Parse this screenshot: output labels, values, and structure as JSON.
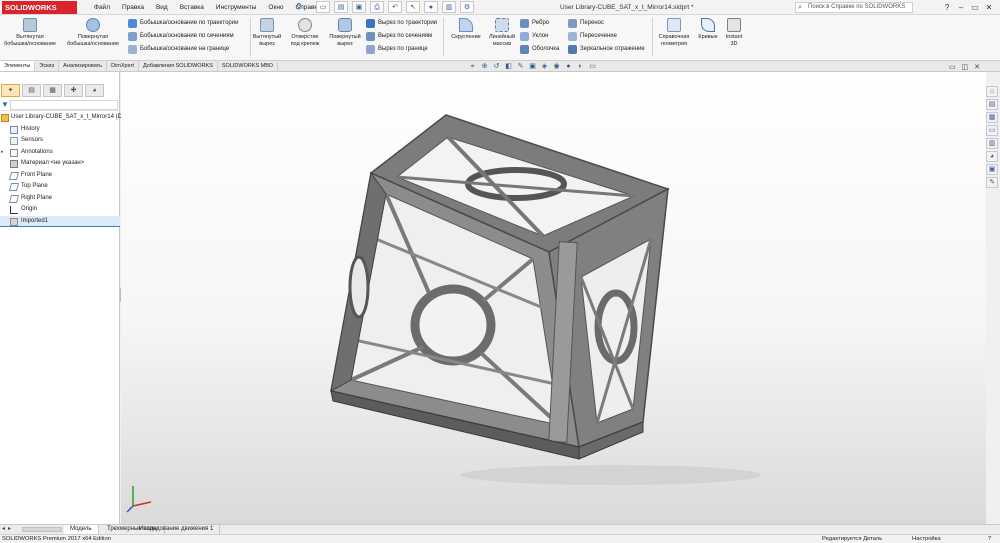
{
  "app": {
    "logo": "SOLIDWORKS",
    "document_title": "User Library-CUBE_SAT_x_t_Mirror14.sldprt *",
    "search_placeholder": "Поиск в Справке по SOLIDWORKS"
  },
  "menu": [
    "Файл",
    "Правка",
    "Вид",
    "Вставка",
    "Инструменты",
    "Окно",
    "Справка"
  ],
  "ribbon": {
    "extruded_boss_line1": "Вытянутая",
    "extruded_boss_line2": "бобышка/основание",
    "revolved_boss_line1": "Повернутая",
    "revolved_boss_line2": "бобышка/основание",
    "swept_boss": "Бобышка/основание по траектории",
    "lofted_boss": "Бобышка/основание по сечениям",
    "boundary_boss": "Бобышка/основание на границе",
    "extruded_cut_line1": "Вытянутый",
    "extruded_cut_line2": "вырез",
    "hole_wizard_line1": "Отверстие",
    "hole_wizard_line2": "под крепеж",
    "revolved_cut_line1": "Повернутый",
    "revolved_cut_line2": "вырез",
    "swept_cut": "Вырез по траектории",
    "lofted_cut": "Вырез по сечениям",
    "boundary_cut": "Вырез по границе",
    "fillet": "Скругление",
    "linear_pattern_line1": "Линейный",
    "linear_pattern_line2": "массив",
    "rib": "Ребро",
    "draft": "Уклон",
    "shell": "Оболочка",
    "wrap": "Перенос",
    "intersect": "Пересечение",
    "mirror": "Зеркальное отражение",
    "ref_geometry_line1": "Справочная",
    "ref_geometry_line2": "геометрия",
    "curves": "Кривые",
    "instant3d_line1": "Instant",
    "instant3d_line2": "3D"
  },
  "command_tabs": [
    "Элементы",
    "Эскиз",
    "Анализировать",
    "DimXpert",
    "Добавления SOLIDWORKS",
    "SOLIDWORKS MBD"
  ],
  "feature_tree": {
    "root": "User Library-CUBE_SAT_x_t_Mirror14  (D",
    "items": [
      "History",
      "Sensors",
      "Annotations",
      "Материал <не указан>",
      "Front Plane",
      "Top Plane",
      "Right Plane",
      "Origin",
      "Imported1"
    ]
  },
  "bottom_tabs": [
    "Модель",
    "Трехмерные виды",
    "Исследование движения 1"
  ],
  "status": {
    "edition": "SOLIDWORKS Premium 2017 x64 Edition",
    "state": "Редактируется Деталь",
    "customize": "Настройка"
  },
  "colors": {
    "brand": "#d8242b",
    "model": "#8c8c8c",
    "selection": "#dceaf8"
  }
}
